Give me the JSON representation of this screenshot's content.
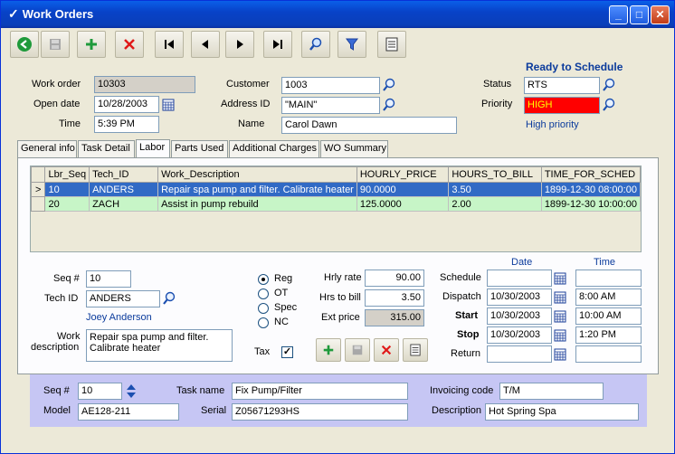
{
  "window": {
    "title": "Work Orders",
    "minimize": "_",
    "maximize": "□",
    "close": "✕"
  },
  "colors": {
    "title_bar": "#0842c8",
    "priority_bg": "#ff0000",
    "priority_fg": "#ffff00",
    "row_selected": "#316ac5",
    "row_alt": "#c7f5c7",
    "bottom_panel": "#c6c6f4"
  },
  "header": {
    "work_order_label": "Work order",
    "work_order": "10303",
    "open_date_label": "Open date",
    "open_date": "10/28/2003",
    "time_label": "Time",
    "time": "5:39 PM",
    "customer_label": "Customer",
    "customer": "1003",
    "address_label": "Address ID",
    "address": "\"MAIN\"",
    "name_label": "Name",
    "name": "Carol Dawn",
    "status_heading": "Ready to Schedule",
    "status_label": "Status",
    "status": "RTS",
    "priority_label": "Priority",
    "priority": "HIGH",
    "priority_desc": "High priority"
  },
  "tabs": [
    {
      "label": "General info"
    },
    {
      "label": "Task Detail"
    },
    {
      "label": "Labor"
    },
    {
      "label": "Parts Used"
    },
    {
      "label": "Additional Charges"
    },
    {
      "label": "WO Summary"
    }
  ],
  "grid": {
    "columns": [
      "Lbr_Seq",
      "Tech_ID",
      "Work_Description",
      "HOURLY_PRICE",
      "HOURS_TO_BILL",
      "TIME_FOR_SCHED"
    ],
    "rows": [
      {
        "indicator": ">",
        "cells": [
          "10",
          "ANDERS",
          "Repair spa pump and filter.  Calibrate heater",
          "90.0000",
          "3.50",
          "1899-12-30 08:00:00"
        ]
      },
      {
        "indicator": "",
        "cells": [
          "20",
          "ZACH",
          "Assist in pump rebuild",
          "125.0000",
          "2.00",
          "1899-12-30 10:00:00"
        ]
      }
    ]
  },
  "labor": {
    "seq_label": "Seq #",
    "seq": "10",
    "tech_label": "Tech ID",
    "tech": "ANDERS",
    "tech_name": "Joey Anderson",
    "desc_label_1": "Work",
    "desc_label_2": "description",
    "desc_line1": "Repair spa pump and filter.",
    "desc_line2": "Calibrate heater",
    "rate_types": [
      "Reg",
      "OT",
      "Spec",
      "NC"
    ],
    "hrly_rate_label": "Hrly rate",
    "hrly_rate": "90.00",
    "hrs_label": "Hrs to bill",
    "hrs": "3.50",
    "ext_label": "Ext price",
    "ext": "315.00",
    "tax_label": "Tax",
    "date_heading": "Date",
    "time_heading": "Time",
    "schedule_label": "Schedule",
    "schedule_date": "",
    "schedule_time": "",
    "dispatch_label": "Dispatch",
    "dispatch_date": "10/30/2003",
    "dispatch_time": "8:00 AM",
    "start_label": "Start",
    "start_date": "10/30/2003",
    "start_time": "10:00 AM",
    "stop_label": "Stop",
    "stop_date": "10/30/2003",
    "stop_time": "1:20 PM",
    "return_label": "Return",
    "return_date": "",
    "return_time": ""
  },
  "task": {
    "seq_label": "Seq #",
    "seq": "10",
    "model_label": "Model",
    "model": "AE128-211",
    "task_name_label": "Task name",
    "task_name": "Fix Pump/Filter",
    "serial_label": "Serial",
    "serial": "Z05671293HS",
    "invoicing_label": "Invoicing code",
    "invoicing": "T/M",
    "description_label": "Description",
    "description": "Hot Spring Spa"
  }
}
